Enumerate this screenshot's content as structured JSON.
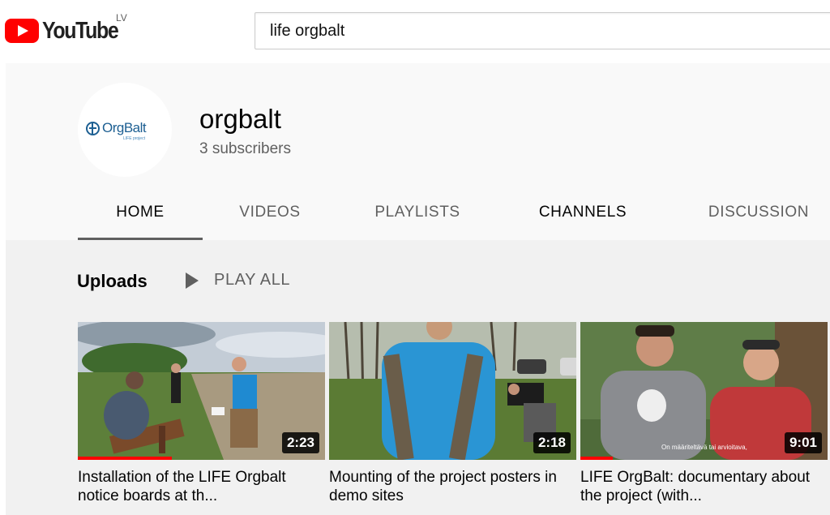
{
  "header": {
    "logo_text": "YouTube",
    "region": "LV",
    "search_value": "life orgbalt"
  },
  "channel": {
    "avatar_logo_text": "OrgBalt",
    "avatar_logo_subtext": "LIFE project",
    "name": "orgbalt",
    "subscribers": "3 subscribers",
    "tabs": [
      {
        "label": "HOME",
        "active": true
      },
      {
        "label": "VIDEOS"
      },
      {
        "label": "PLAYLISTS"
      },
      {
        "label": "CHANNELS"
      },
      {
        "label": "DISCUSSION"
      }
    ]
  },
  "uploads": {
    "title": "Uploads",
    "play_all": "PLAY ALL",
    "videos": [
      {
        "title": "Installation of the LIFE Orgbalt notice boards at th...",
        "duration": "2:23",
        "watched_fraction": 0.38
      },
      {
        "title": "Mounting of the project posters in demo sites",
        "duration": "2:18"
      },
      {
        "title": "LIFE OrgBalt: documentary about the project (with...",
        "duration": "9:01",
        "watched_fraction": 0.13,
        "caption": "On määriteltävä tai arvioitava,"
      }
    ]
  },
  "colors": {
    "brand_red": "#ff0000",
    "header_bg": "#f9f9f9",
    "content_bg": "#f1f1f1",
    "muted_text": "#606060"
  }
}
